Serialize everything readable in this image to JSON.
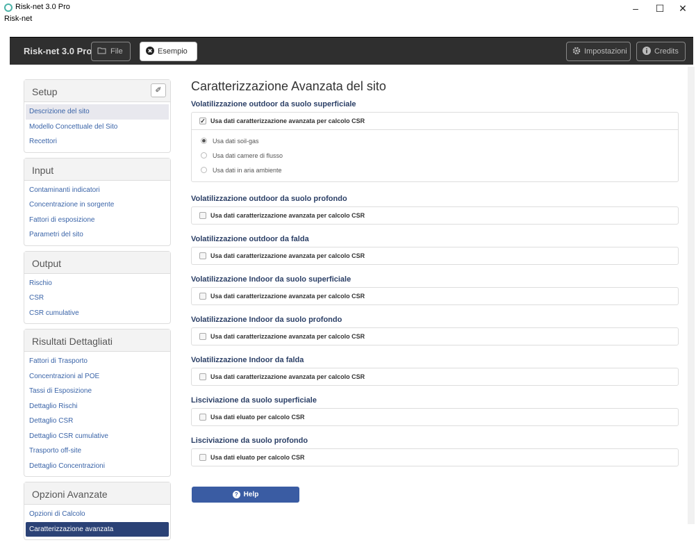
{
  "window": {
    "title": "Risk-net 3.0 Pro",
    "menu": "Risk-net",
    "controls": [
      "–",
      "☐",
      "✕"
    ]
  },
  "navbar": {
    "brand": "Risk-net 3.0 Pro",
    "file_label": "File",
    "esempio_label": "Esempio",
    "impostazioni_label": "Impostazioni",
    "credits_label": "Credits"
  },
  "sidebar": {
    "setup": {
      "title": "Setup",
      "items": [
        "Descrizione del sito",
        "Modello Concettuale del Sito",
        "Recettori"
      ]
    },
    "input": {
      "title": "Input",
      "items": [
        "Contaminanti indicatori",
        "Concentrazione in sorgente",
        "Fattori di esposizione",
        "Parametri del sito"
      ]
    },
    "output": {
      "title": "Output",
      "items": [
        "Rischio",
        "CSR",
        "CSR cumulative"
      ]
    },
    "risultati": {
      "title": "Risultati Dettagliati",
      "items": [
        "Fattori di Trasporto",
        "Concentrazioni al POE",
        "Tassi di Esposizione",
        "Dettaglio Rischi",
        "Dettaglio CSR",
        "Dettaglio CSR cumulative",
        "Trasporto off-site",
        "Dettaglio Concentrazioni"
      ]
    },
    "opzioni": {
      "title": "Opzioni Avanzate",
      "items": [
        "Opzioni di Calcolo",
        "Caratterizzazione avanzata"
      ]
    }
  },
  "main": {
    "title": "Caratterizzazione Avanzata del sito",
    "sections": [
      {
        "title": "Volatilizzazione outdoor da suolo superficiale",
        "checkbox": "Usa dati caratterizzazione avanzata per calcolo CSR",
        "checked": true
      },
      {
        "title": "Volatilizzazione outdoor da suolo profondo",
        "checkbox": "Usa dati caratterizzazione avanzata per calcolo CSR",
        "checked": false
      },
      {
        "title": "Volatilizzazione outdoor da falda",
        "checkbox": "Usa dati caratterizzazione avanzata per calcolo CSR",
        "checked": false
      },
      {
        "title": "Volatilizzazione Indoor da suolo superficiale",
        "checkbox": "Usa dati caratterizzazione avanzata per calcolo CSR",
        "checked": false
      },
      {
        "title": "Volatilizzazione Indoor da suolo profondo",
        "checkbox": "Usa dati caratterizzazione avanzata per calcolo CSR",
        "checked": false
      },
      {
        "title": "Volatilizzazione Indoor da falda",
        "checkbox": "Usa dati caratterizzazione avanzata per calcolo CSR",
        "checked": false
      },
      {
        "title": "Lisciviazione da suolo superficiale",
        "checkbox": "Usa dati eluato per calcolo CSR",
        "checked": false
      },
      {
        "title": "Lisciviazione da suolo profondo",
        "checkbox": "Usa dati eluato per calcolo CSR",
        "checked": false
      }
    ],
    "radios": [
      "Usa dati soil-gas",
      "Usa dati camere di flusso",
      "Usa dati in aria ambiente"
    ],
    "radio_selected": 0,
    "help_label": "Help"
  }
}
